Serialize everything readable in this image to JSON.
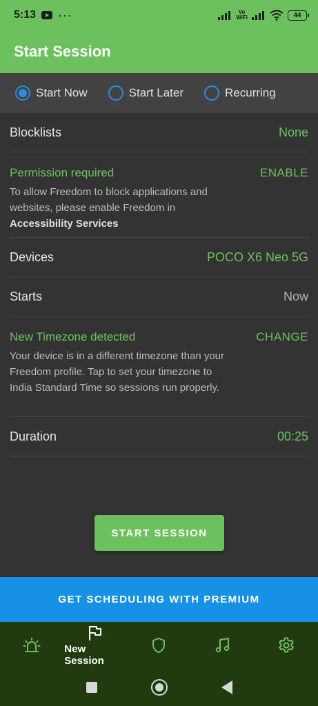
{
  "status_bar": {
    "time": "5:13",
    "vowifi_top": "Vo",
    "vowifi_bottom": "WiFi",
    "battery": "44"
  },
  "app_bar": {
    "title": "Start Session"
  },
  "start_options": [
    {
      "label": "Start Now",
      "selected": true
    },
    {
      "label": "Start Later",
      "selected": false
    },
    {
      "label": "Recurring",
      "selected": false
    }
  ],
  "rows": {
    "blocklists": {
      "label": "Blocklists",
      "value": "None"
    },
    "permission": {
      "title": "Permission required",
      "desc": "To allow Freedom to block applications and websites, please enable Freedom in",
      "desc_bold": "Accessibility Services",
      "action": "ENABLE"
    },
    "devices": {
      "label": "Devices",
      "value": "POCO X6 Neo 5G"
    },
    "starts": {
      "label": "Starts",
      "value": "Now"
    },
    "timezone": {
      "title": "New Timezone detected",
      "desc": "Your device is in a different timezone than your Freedom profile. Tap to set your timezone to India Standard Time so sessions run properly.",
      "action": "CHANGE"
    },
    "duration": {
      "label": "Duration",
      "value": "00:25"
    }
  },
  "start_button": "START SESSION",
  "premium_banner": "GET SCHEDULING WITH PREMIUM",
  "bottom_nav": {
    "active_label": "New Session",
    "icons": [
      "alarm-icon",
      "flag-icon",
      "shield-icon",
      "music-icon",
      "gear-icon"
    ]
  },
  "colors": {
    "accent_green": "#6cc05e",
    "radio_blue": "#2d8ce0",
    "premium_blue": "#1691e6",
    "nav_bg": "#213a0f",
    "content_bg": "#333333"
  }
}
